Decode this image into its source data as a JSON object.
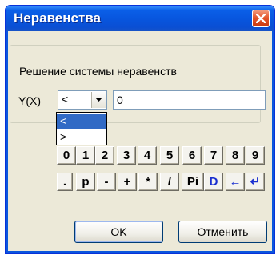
{
  "window": {
    "title": "Неравенства"
  },
  "group": {
    "label": "Решение системы неравенств"
  },
  "yx_label": "Y(X)",
  "combo": {
    "value": "<",
    "options": [
      "<",
      ">"
    ]
  },
  "input": {
    "value": "0"
  },
  "keypad": {
    "row1": [
      "0",
      "1",
      "2",
      "3",
      "4",
      "5",
      "6",
      "7",
      "8",
      "9"
    ],
    "row2": [
      ".",
      "p",
      "-",
      "+",
      "*",
      "/",
      "Pi",
      "D",
      "←",
      "↵"
    ]
  },
  "buttons": {
    "ok": "OK",
    "cancel": "Отменить"
  },
  "colors": {
    "title_bar": "#0855dd",
    "selection": "#316ac5",
    "key_blue": "#1a2fd0"
  }
}
